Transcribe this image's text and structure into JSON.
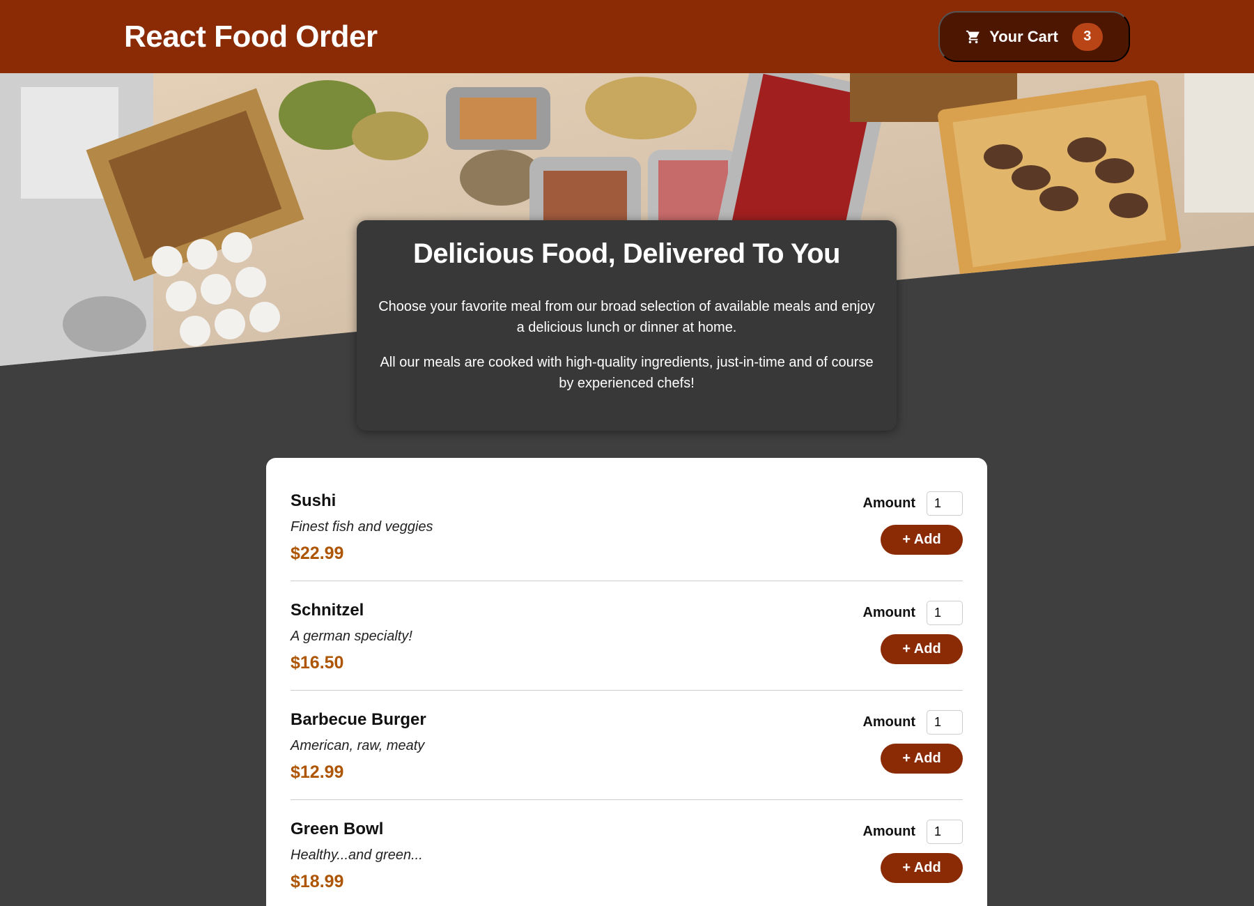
{
  "header": {
    "title": "React Food Order",
    "cart": {
      "label": "Your Cart",
      "count": "3",
      "icon": "cart-icon"
    }
  },
  "colors": {
    "header": "#8a2b06",
    "cart_button": "#4d1601",
    "badge": "#b94517",
    "background": "#3f3f3f",
    "price": "#ad5502"
  },
  "summary": {
    "heading": "Delicious Food, Delivered To You",
    "paragraphs": [
      "Choose your favorite meal from our broad selection of available meals and enjoy a delicious lunch or dinner at home.",
      "All our meals are cooked with high-quality ingredients, just-in-time and of course by experienced chefs!"
    ]
  },
  "meals": [
    {
      "name": "Sushi",
      "description": "Finest fish and veggies",
      "price": "$22.99",
      "amount_label": "Amount",
      "amount": "1",
      "add_label": "+ Add"
    },
    {
      "name": "Schnitzel",
      "description": "A german specialty!",
      "price": "$16.50",
      "amount_label": "Amount",
      "amount": "1",
      "add_label": "+ Add"
    },
    {
      "name": "Barbecue Burger",
      "description": "American, raw, meaty",
      "price": "$12.99",
      "amount_label": "Amount",
      "amount": "1",
      "add_label": "+ Add"
    },
    {
      "name": "Green Bowl",
      "description": "Healthy...and green...",
      "price": "$18.99",
      "amount_label": "Amount",
      "amount": "1",
      "add_label": "+ Add"
    }
  ]
}
